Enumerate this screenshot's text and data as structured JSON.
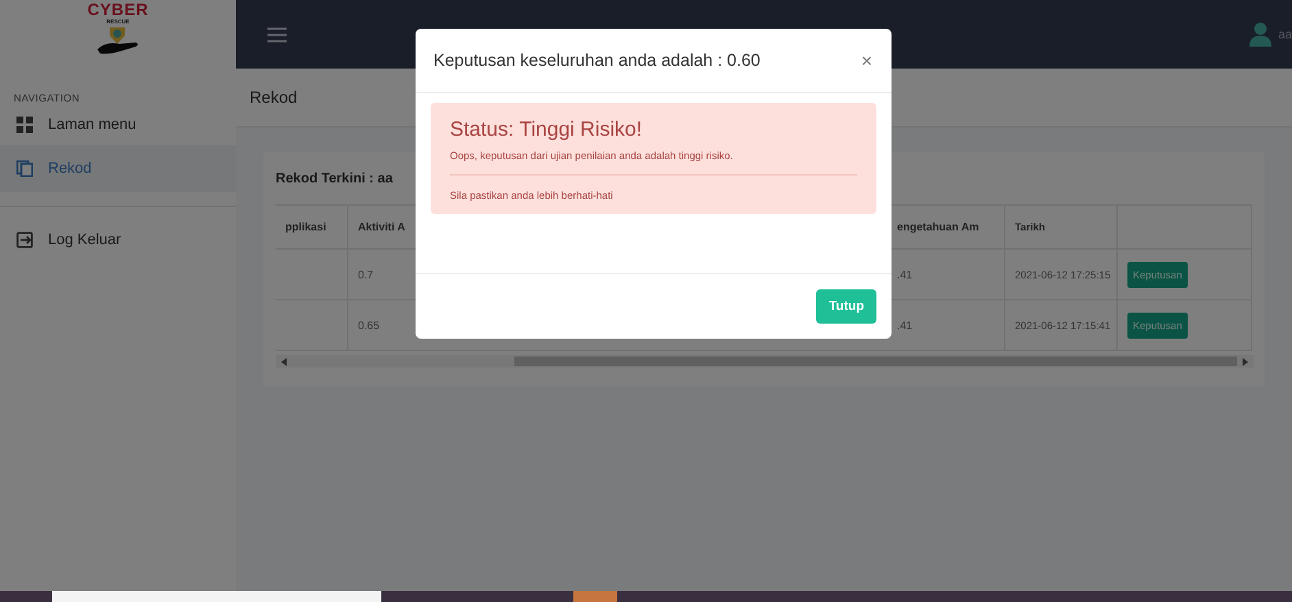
{
  "sidebar": {
    "logo": {
      "title": "CYBER",
      "subtitle": "RESCUE"
    },
    "section": "NAVIGATION",
    "items": [
      {
        "label": "Laman menu",
        "selected": false
      },
      {
        "label": "Rekod",
        "selected": true
      },
      {
        "label": "Log Keluar",
        "selected": false
      }
    ]
  },
  "topbar": {
    "user": "aa"
  },
  "page_title": "Rekod",
  "card": {
    "title": "Rekod Terkini : aa",
    "table": {
      "columns": [
        "pplikasi",
        "Aktiviti A",
        "engetahuan Am",
        "Tarikh"
      ],
      "rows": [
        {
          "column_2": "0.7",
          "column_3": ".41",
          "tarikh": "2021-06-12 17:25:15",
          "action": "Keputusan"
        },
        {
          "column_2": "0.65",
          "column_3": ".41",
          "tarikh": "2021-06-12 17:15:41",
          "action": "Keputusan"
        }
      ]
    }
  },
  "modal": {
    "title": "Keputusan keseluruhan anda adalah : 0.60",
    "close": "×",
    "alert": {
      "kind": "danger",
      "heading": "Status: Tinggi Risiko!",
      "message": "Oops, keputusan dari ujian penilaian anda adalah tinggi risiko.",
      "note": "Sila pastikan anda lebih berhati-hati"
    },
    "buttons": [
      "Tutup"
    ]
  }
}
